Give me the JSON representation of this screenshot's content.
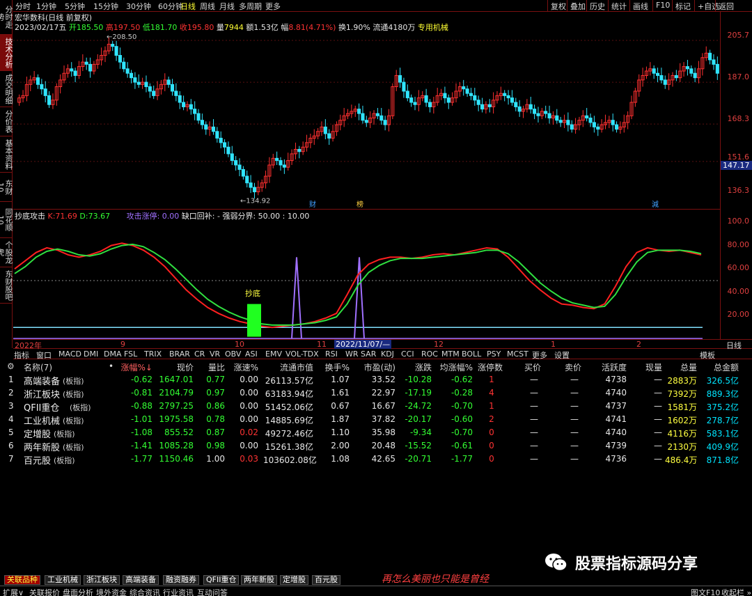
{
  "left_tabs": [
    "分时走势",
    "技术分析",
    "成交明细",
    "分价表",
    "基本资料",
    "东财10",
    "同花顺10",
    "个股龙虎",
    "东财股吧"
  ],
  "left_tab_active": 1,
  "toolbar": {
    "periods": [
      "分时",
      "1分钟",
      "5分钟",
      "15分钟",
      "30分钟",
      "60分钟",
      "日线",
      "周线",
      "月线",
      "多周期",
      "更多"
    ],
    "active": "日线",
    "right_buttons": [
      "复权",
      "叠加",
      "历史",
      "统计",
      "画线",
      "F10",
      "标记",
      "+自选",
      "返回"
    ]
  },
  "stock": {
    "name": "宏华数科(日线 前复权)",
    "date": "2023/02/17五",
    "open_label": "开",
    "open": "185.50",
    "high_label": "高",
    "high": "197.50",
    "low_label": "低",
    "low": "181.70",
    "close_label": "收",
    "close": "195.80",
    "vol_label": "量",
    "vol": "7944",
    "amt_label": "额",
    "amt": "1.53亿",
    "chg_label": "幅",
    "chg": "8.81(4.71%)",
    "turnover": "换1.90%",
    "float": "流通4180万",
    "sector": "专用机械"
  },
  "kchart": {
    "axis_labels": [
      "205.7",
      "187.0",
      "168.3",
      "151.6",
      "136.3"
    ],
    "current_price": "147.17",
    "high_mark": "208.50",
    "low_mark": "134.92",
    "event_labels": [
      "财",
      "榜",
      "減"
    ]
  },
  "indicator": {
    "name": "抄底攻击",
    "k_label": "K:",
    "k": "71.69",
    "d_label": "D:",
    "d": "73.67",
    "attack": "攻击涨停: 0.00",
    "gap": "缺口回补: -",
    "strength": "强弱分界: 50.00 : 10.00",
    "axis_labels": [
      "100.0",
      "80.00",
      "60.00",
      "40.00",
      "20.00"
    ],
    "signal_label": "抄底"
  },
  "date_axis": {
    "labels": [
      "2022年",
      "9",
      "10",
      "11",
      "2022/11/07/—",
      "12",
      "1",
      "2"
    ],
    "right": "日线"
  },
  "indicator_tabs": [
    "指标",
    "窗口",
    "MACD",
    "DMI",
    "DMA",
    "FSL",
    "TRIX",
    "BRAR",
    "CR",
    "VR",
    "OBV",
    "ASI",
    "EMV",
    "VOL-TDX",
    "RSI",
    "WR",
    "SAR",
    "KDJ",
    "CCI",
    "ROC",
    "MTM",
    "BOLL",
    "PSY",
    "MCST",
    "更多",
    "设置"
  ],
  "indicator_tabs_right": "模板",
  "table": {
    "headers": [
      "名称(7)",
      "•",
      "涨幅%↓",
      "现价",
      "量比",
      "涨速%",
      "流通市值",
      "换手%",
      "市盈(动)",
      "涨跌",
      "均涨幅%",
      "涨停数",
      "买价",
      "卖价",
      "活跃度",
      "现量",
      "总量",
      "总金额"
    ],
    "rows": [
      {
        "no": "1",
        "name": "高端装备",
        "tag": "(板指)",
        "chg": "-0.62",
        "price": "1647.01",
        "lb": "0.77",
        "speed": "0.00",
        "mv": "26113.57亿",
        "turn": "1.07",
        "pe": "33.52",
        "diff": "-10.28",
        "avg": "-0.62",
        "zt": "1",
        "buy": "—",
        "sell": "—",
        "act": "4738",
        "cur": "—",
        "vol": "2883万",
        "amt": "326.5亿"
      },
      {
        "no": "2",
        "name": "浙江板块",
        "tag": "(板指)",
        "chg": "-0.81",
        "price": "2104.79",
        "lb": "0.97",
        "speed": "0.00",
        "mv": "63183.94亿",
        "turn": "1.61",
        "pe": "22.97",
        "diff": "-17.19",
        "avg": "-0.28",
        "zt": "4",
        "buy": "—",
        "sell": "—",
        "act": "4740",
        "cur": "—",
        "vol": "7392万",
        "amt": "889.3亿"
      },
      {
        "no": "3",
        "name": "QFII重仓",
        "tag": "(板指)",
        "chg": "-0.88",
        "price": "2797.25",
        "lb": "0.86",
        "speed": "0.00",
        "mv": "51452.06亿",
        "turn": "0.67",
        "pe": "16.67",
        "diff": "-24.72",
        "avg": "-0.70",
        "zt": "1",
        "buy": "—",
        "sell": "—",
        "act": "4737",
        "cur": "—",
        "vol": "1581万",
        "amt": "375.2亿"
      },
      {
        "no": "4",
        "name": "工业机械",
        "tag": "(板指)",
        "chg": "-1.01",
        "price": "1975.58",
        "lb": "0.78",
        "speed": "0.00",
        "mv": "14885.69亿",
        "turn": "1.87",
        "pe": "37.82",
        "diff": "-20.17",
        "avg": "-0.60",
        "zt": "2",
        "buy": "—",
        "sell": "—",
        "act": "4741",
        "cur": "—",
        "vol": "1602万",
        "amt": "278.7亿"
      },
      {
        "no": "5",
        "name": "定增股",
        "tag": "(板指)",
        "chg": "-1.08",
        "price": "855.52",
        "lb": "0.87",
        "speed": "0.02",
        "mv": "49272.46亿",
        "turn": "1.10",
        "pe": "35.98",
        "diff": "-9.34",
        "avg": "-0.70",
        "zt": "0",
        "buy": "—",
        "sell": "—",
        "act": "4740",
        "cur": "—",
        "vol": "4116万",
        "amt": "583.1亿"
      },
      {
        "no": "6",
        "name": "两年新股",
        "tag": "(板指)",
        "chg": "-1.41",
        "price": "1085.28",
        "lb": "0.98",
        "speed": "0.00",
        "mv": "15261.38亿",
        "turn": "2.00",
        "pe": "20.48",
        "diff": "-15.52",
        "avg": "-0.61",
        "zt": "0",
        "buy": "—",
        "sell": "—",
        "act": "4739",
        "cur": "—",
        "vol": "2130万",
        "amt": "409.9亿"
      },
      {
        "no": "7",
        "name": "百元股",
        "tag": "(板指)",
        "chg": "-1.77",
        "price": "1150.46",
        "lb": "1.00",
        "speed": "0.03",
        "mv": "103602.08亿",
        "turn": "1.08",
        "pe": "42.65",
        "diff": "-20.71",
        "avg": "-1.77",
        "zt": "0",
        "buy": "—",
        "sell": "—",
        "act": "4736",
        "cur": "—",
        "vol": "486.4万",
        "amt": "871.8亿"
      }
    ]
  },
  "watermark": {
    "brand": "股票指标源码分享",
    "slogan": "再怎么美丽也只能是曾经"
  },
  "sector_tabs": [
    "关联品种",
    "工业机械",
    "浙江板块",
    "高端装备",
    "融资融券",
    "QFII重仓",
    "两年新股",
    "定增股",
    "百元股"
  ],
  "bottom_bar": [
    "扩展∨",
    "关联报价",
    "盘面分析",
    "境外资金",
    "综合资讯",
    "行业资讯",
    "互动问答"
  ],
  "bottom_right": [
    "图文F10",
    "收起栏 »"
  ]
}
